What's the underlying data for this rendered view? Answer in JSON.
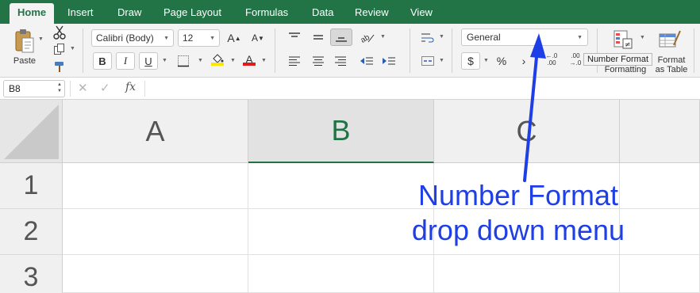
{
  "tabs": [
    {
      "label": "Home",
      "active": true
    },
    {
      "label": "Insert"
    },
    {
      "label": "Draw"
    },
    {
      "label": "Page Layout"
    },
    {
      "label": "Formulas"
    },
    {
      "label": "Data"
    },
    {
      "label": "Review"
    },
    {
      "label": "View"
    }
  ],
  "clipboard": {
    "paste_label": "Paste"
  },
  "font": {
    "family": "Calibri (Body)",
    "size": "12",
    "grow_label": "A",
    "shrink_label": "A",
    "bold": "B",
    "italic": "I",
    "underline": "U",
    "font_color_glyph": "A"
  },
  "number": {
    "format_value": "General",
    "currency": "$",
    "percent": "%",
    "comma": "›",
    "increase_decimal_top": "←.0",
    "increase_decimal_bottom": ".00",
    "decrease_decimal_top": ".00",
    "decrease_decimal_bottom": "→.0"
  },
  "styles": {
    "conditional_formatting_label": "Formatting",
    "format_table_line1": "Format",
    "format_table_line2": "as Table"
  },
  "tooltip": "Number Format",
  "formula_bar": {
    "name_box": "B8",
    "fx": "fx",
    "cancel": "✕",
    "enter": "✓"
  },
  "grid": {
    "columns": [
      "A",
      "B",
      "C"
    ],
    "selected_column": "B",
    "rows": [
      "1",
      "2",
      "3"
    ]
  },
  "annotation": {
    "line1": "Number Format",
    "line2": "drop down menu"
  },
  "colors": {
    "tab_bar": "#227447",
    "selected_header_text": "#217346",
    "annotation": "#1f3fe6",
    "highlight_yellow": "#ffe600",
    "font_red": "#e01b1b"
  }
}
